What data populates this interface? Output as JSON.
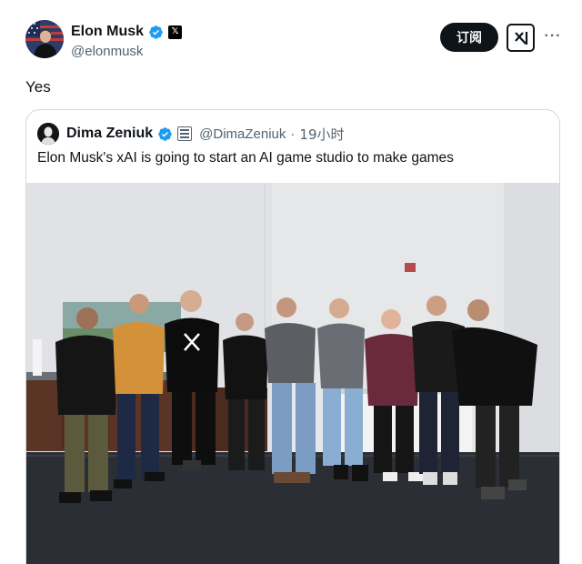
{
  "post": {
    "author": {
      "name": "Elon Musk",
      "handle": "@elonmusk",
      "avatar_icon": "elon-avatar-photo",
      "verified_icon": "verified-badge-icon",
      "affiliate_icon": "x-logo-badge-icon"
    },
    "subscribe_label": "订阅",
    "grok_icon": "grok-icon",
    "more_label": "···",
    "text": "Yes"
  },
  "quote": {
    "author": {
      "name": "Dima Zeniuk",
      "handle": "@DimaZeniuk",
      "avatar_icon": "dima-avatar-photo",
      "verified_icon": "verified-badge-icon",
      "affiliate_icon": "newspaper-badge-icon"
    },
    "separator": "·",
    "time": "19小时",
    "text": "Elon Musk's xAI is going to start an AI game studio to make games",
    "photo_icon": "group-photo"
  },
  "colors": {
    "text_primary": "#0f1419",
    "text_secondary": "#536471",
    "verified_blue": "#1d9bf0",
    "border": "#cfd9de"
  }
}
